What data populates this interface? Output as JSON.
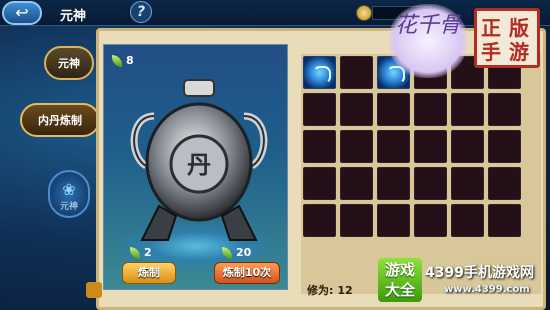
{
  "header": {
    "back_icon": "back-arrow-icon",
    "title": "元神",
    "help_label": "?"
  },
  "sidebar": {
    "tab_yuanshen": "元神",
    "tab_refine": "内丹炼制",
    "tab_yuanshen_icon_label": "元神"
  },
  "furnace": {
    "top_count": "8",
    "left_count": "2",
    "right_count": "20",
    "refine_button": "炼制",
    "refine10_button": "炼制10次",
    "center_emblem": "丹"
  },
  "inventory": {
    "power_label": "修为:",
    "power_value": "12",
    "rows": 5,
    "cols": 6,
    "orb_slots": [
      0,
      2
    ]
  },
  "branding": {
    "badge_text": "花千骨",
    "logo_chars": [
      "正",
      "版",
      "手",
      "游"
    ],
    "watermark_box": [
      "游戏",
      "大全"
    ],
    "watermark_text": "4399手机游戏网",
    "watermark_url": "www.4399.com"
  },
  "colors": {
    "accent_gold": "#d9b45d",
    "panel_beige": "#e9dcb8",
    "slot_dark": "#241019"
  }
}
